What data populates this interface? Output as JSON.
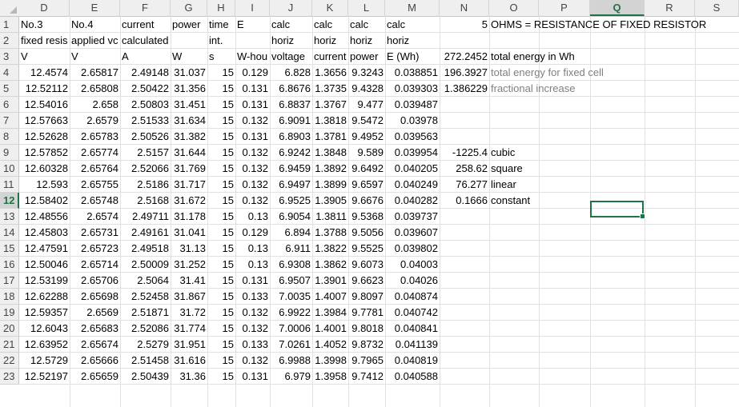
{
  "columns": [
    "D",
    "E",
    "F",
    "G",
    "H",
    "I",
    "J",
    "K",
    "L",
    "M",
    "N",
    "O",
    "P",
    "Q",
    "R",
    "S"
  ],
  "selected_column": "Q",
  "selected_row": "12",
  "rows": [
    {
      "n": "1",
      "D": "No.3",
      "E": "No.4",
      "F": "current",
      "G": "power",
      "H": "time",
      "I": "E",
      "J": "calc",
      "K": "calc",
      "L": "calc",
      "M": "calc",
      "N": "5",
      "O": "OHMS = RESISTANCE OF FIXED RESISTOR"
    },
    {
      "n": "2",
      "D": "fixed resis",
      "E": "applied vc",
      "F": "calculated",
      "G": "",
      "H": "int.",
      "I": "",
      "J": "horiz",
      "K": "horiz",
      "L": "horiz",
      "M": "horiz"
    },
    {
      "n": "3",
      "D": "V",
      "E": "V",
      "F": "A",
      "G": "W",
      "H": "s",
      "I": "W-hou",
      "J": "voltage",
      "K": "current",
      "L": "power",
      "M": "E (Wh)",
      "N": "272.2452",
      "O": "total energy in Wh"
    },
    {
      "n": "4",
      "D": "12.4574",
      "E": "2.65817",
      "F": "2.49148",
      "G": "31.037",
      "H": "15",
      "I": "0.129",
      "J": "6.828",
      "K": "1.3656",
      "L": "9.3243",
      "M": "0.038851",
      "N": "196.3927",
      "O": "total energy for fixed cell"
    },
    {
      "n": "5",
      "D": "12.52112",
      "E": "2.65808",
      "F": "2.50422",
      "G": "31.356",
      "H": "15",
      "I": "0.131",
      "J": "6.8676",
      "K": "1.3735",
      "L": "9.4328",
      "M": "0.039303",
      "N": "1.386229",
      "O": "fractional increase"
    },
    {
      "n": "6",
      "D": "12.54016",
      "E": "2.658",
      "F": "2.50803",
      "G": "31.451",
      "H": "15",
      "I": "0.131",
      "J": "6.8837",
      "K": "1.3767",
      "L": "9.477",
      "M": "0.039487"
    },
    {
      "n": "7",
      "D": "12.57663",
      "E": "2.6579",
      "F": "2.51533",
      "G": "31.634",
      "H": "15",
      "I": "0.132",
      "J": "6.9091",
      "K": "1.3818",
      "L": "9.5472",
      "M": "0.03978"
    },
    {
      "n": "8",
      "D": "12.52628",
      "E": "2.65783",
      "F": "2.50526",
      "G": "31.382",
      "H": "15",
      "I": "0.131",
      "J": "6.8903",
      "K": "1.3781",
      "L": "9.4952",
      "M": "0.039563"
    },
    {
      "n": "9",
      "D": "12.57852",
      "E": "2.65774",
      "F": "2.5157",
      "G": "31.644",
      "H": "15",
      "I": "0.132",
      "J": "6.9242",
      "K": "1.3848",
      "L": "9.589",
      "M": "0.039954",
      "N": "-1225.4",
      "O": "cubic"
    },
    {
      "n": "10",
      "D": "12.60328",
      "E": "2.65764",
      "F": "2.52066",
      "G": "31.769",
      "H": "15",
      "I": "0.132",
      "J": "6.9459",
      "K": "1.3892",
      "L": "9.6492",
      "M": "0.040205",
      "N": "258.62",
      "O": "square"
    },
    {
      "n": "11",
      "D": "12.593",
      "E": "2.65755",
      "F": "2.5186",
      "G": "31.717",
      "H": "15",
      "I": "0.132",
      "J": "6.9497",
      "K": "1.3899",
      "L": "9.6597",
      "M": "0.040249",
      "N": "76.277",
      "O": "linear"
    },
    {
      "n": "12",
      "D": "12.58402",
      "E": "2.65748",
      "F": "2.5168",
      "G": "31.672",
      "H": "15",
      "I": "0.132",
      "J": "6.9525",
      "K": "1.3905",
      "L": "9.6676",
      "M": "0.040282",
      "N": "0.1666",
      "O": "constant"
    },
    {
      "n": "13",
      "D": "12.48556",
      "E": "2.6574",
      "F": "2.49711",
      "G": "31.178",
      "H": "15",
      "I": "0.13",
      "J": "6.9054",
      "K": "1.3811",
      "L": "9.5368",
      "M": "0.039737"
    },
    {
      "n": "14",
      "D": "12.45803",
      "E": "2.65731",
      "F": "2.49161",
      "G": "31.041",
      "H": "15",
      "I": "0.129",
      "J": "6.894",
      "K": "1.3788",
      "L": "9.5056",
      "M": "0.039607"
    },
    {
      "n": "15",
      "D": "12.47591",
      "E": "2.65723",
      "F": "2.49518",
      "G": "31.13",
      "H": "15",
      "I": "0.13",
      "J": "6.911",
      "K": "1.3822",
      "L": "9.5525",
      "M": "0.039802"
    },
    {
      "n": "16",
      "D": "12.50046",
      "E": "2.65714",
      "F": "2.50009",
      "G": "31.252",
      "H": "15",
      "I": "0.13",
      "J": "6.9308",
      "K": "1.3862",
      "L": "9.6073",
      "M": "0.04003"
    },
    {
      "n": "17",
      "D": "12.53199",
      "E": "2.65706",
      "F": "2.5064",
      "G": "31.41",
      "H": "15",
      "I": "0.131",
      "J": "6.9507",
      "K": "1.3901",
      "L": "9.6623",
      "M": "0.04026"
    },
    {
      "n": "18",
      "D": "12.62288",
      "E": "2.65698",
      "F": "2.52458",
      "G": "31.867",
      "H": "15",
      "I": "0.133",
      "J": "7.0035",
      "K": "1.4007",
      "L": "9.8097",
      "M": "0.040874"
    },
    {
      "n": "19",
      "D": "12.59357",
      "E": "2.6569",
      "F": "2.51871",
      "G": "31.72",
      "H": "15",
      "I": "0.132",
      "J": "6.9922",
      "K": "1.3984",
      "L": "9.7781",
      "M": "0.040742"
    },
    {
      "n": "20",
      "D": "12.6043",
      "E": "2.65683",
      "F": "2.52086",
      "G": "31.774",
      "H": "15",
      "I": "0.132",
      "J": "7.0006",
      "K": "1.4001",
      "L": "9.8018",
      "M": "0.040841"
    },
    {
      "n": "21",
      "D": "12.63952",
      "E": "2.65674",
      "F": "2.5279",
      "G": "31.951",
      "H": "15",
      "I": "0.133",
      "J": "7.0261",
      "K": "1.4052",
      "L": "9.8732",
      "M": "0.041139"
    },
    {
      "n": "22",
      "D": "12.5729",
      "E": "2.65666",
      "F": "2.51458",
      "G": "31.616",
      "H": "15",
      "I": "0.132",
      "J": "6.9988",
      "K": "1.3998",
      "L": "9.7965",
      "M": "0.040819"
    },
    {
      "n": "23",
      "D": "12.52197",
      "E": "2.65659",
      "F": "2.50439",
      "G": "31.36",
      "H": "15",
      "I": "0.131",
      "J": "6.979",
      "K": "1.3958",
      "L": "9.7412",
      "M": "0.040588"
    }
  ],
  "colors": {
    "accent": "#217346",
    "header_bg": "#efefef",
    "selected_header_bg": "#d3d3d3",
    "grid": "#e1e1e1",
    "note_text": "#7f7f7f"
  }
}
